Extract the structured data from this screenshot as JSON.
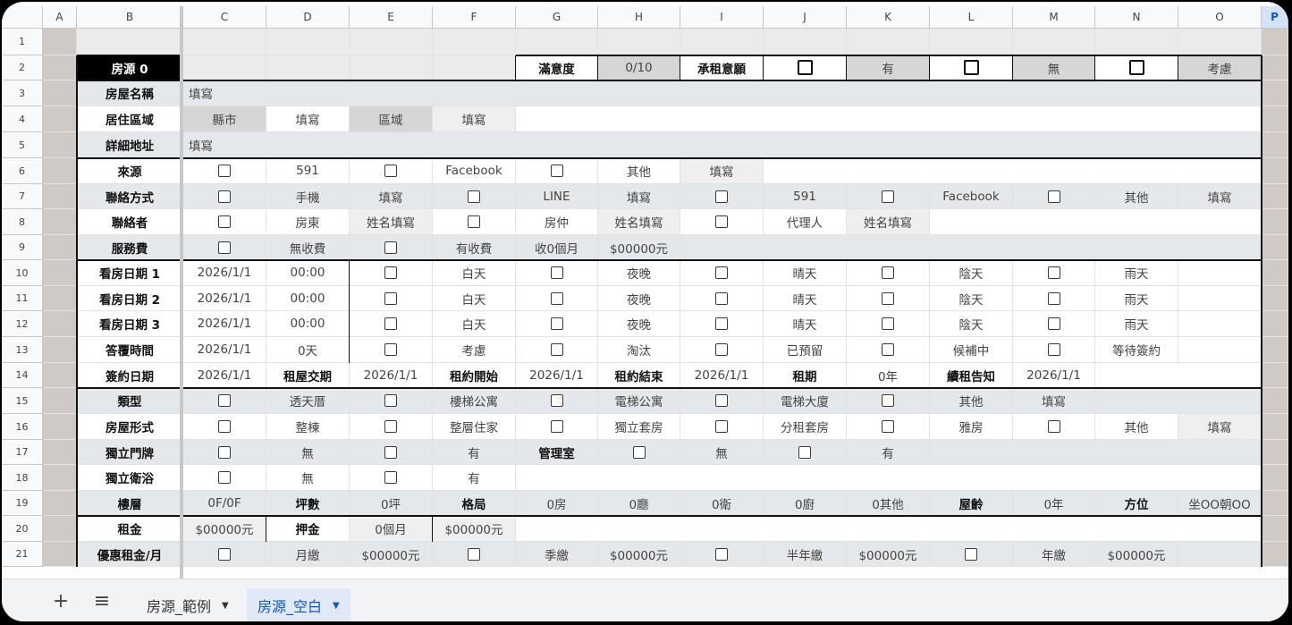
{
  "columns": [
    "A",
    "B",
    "C",
    "D",
    "E",
    "F",
    "G",
    "H",
    "I",
    "J",
    "K",
    "L",
    "M",
    "N",
    "O",
    "P"
  ],
  "selected_column": "P",
  "rows": [
    "1",
    "2",
    "3",
    "4",
    "5",
    "6",
    "7",
    "8",
    "9",
    "10",
    "11",
    "12",
    "13",
    "14",
    "15",
    "16",
    "17",
    "18",
    "19",
    "20",
    "21"
  ],
  "cells": {
    "B2": "房源 0",
    "G2": "滿意度",
    "H2": "0/10",
    "I2": "承租意願",
    "K2": "有",
    "M2": "無",
    "O2": "考慮",
    "B3": "房屋名稱",
    "C3": "填寫",
    "B4": "居住區域",
    "C4": "縣市",
    "D4": "填寫",
    "E4": "區域",
    "F4": "填寫",
    "B5": "詳細地址",
    "C5": "填寫",
    "B6": "來源",
    "D6": "591",
    "F6": "Facebook",
    "H6": "其他",
    "I6": "填寫",
    "B7": "聯絡方式",
    "D7": "手機",
    "E7": "填寫",
    "G7": "LINE",
    "H7": "填寫",
    "J7": "591",
    "L7": "Facebook",
    "N7": "其他",
    "O7": "填寫",
    "B8": "聯絡者",
    "D8": "房東",
    "E8": "姓名填寫",
    "G8": "房仲",
    "H8": "姓名填寫",
    "J8": "代理人",
    "K8": "姓名填寫",
    "B9": "服務費",
    "D9": "無收費",
    "F9": "有收費",
    "G9": "收0個月",
    "H9": "$00000元",
    "B10": "看房日期 1",
    "C10": "2026/1/1",
    "D10": "00:00",
    "F10": "白天",
    "H10": "夜晚",
    "J10": "晴天",
    "L10": "陰天",
    "N10": "雨天",
    "B11": "看房日期 2",
    "C11": "2026/1/1",
    "D11": "00:00",
    "F11": "白天",
    "H11": "夜晚",
    "J11": "晴天",
    "L11": "陰天",
    "N11": "雨天",
    "B12": "看房日期 3",
    "C12": "2026/1/1",
    "D12": "00:00",
    "F12": "白天",
    "H12": "夜晚",
    "J12": "晴天",
    "L12": "陰天",
    "N12": "雨天",
    "B13": "答覆時間",
    "C13": "2026/1/1",
    "D13": "0天",
    "F13": "考慮",
    "H13": "淘汰",
    "J13": "已預留",
    "L13": "候補中",
    "N13": "等待簽約",
    "B14": "簽約日期",
    "C14": "2026/1/1",
    "D14": "租屋交期",
    "E14": "2026/1/1",
    "F14": "租約開始",
    "G14": "2026/1/1",
    "H14": "租約結束",
    "I14": "2026/1/1",
    "J14": "租期",
    "K14": "0年",
    "L14": "續租告知",
    "M14": "2026/1/1",
    "B15": "類型",
    "D15": "透天厝",
    "F15": "樓梯公寓",
    "H15": "電梯公寓",
    "J15": "電梯大廈",
    "L15": "其他",
    "M15": "填寫",
    "B16": "房屋形式",
    "D16": "整棟",
    "F16": "整層住家",
    "H16": "獨立套房",
    "J16": "分租套房",
    "L16": "雅房",
    "N16": "其他",
    "O16": "填寫",
    "B17": "獨立門牌",
    "D17": "無",
    "F17": "有",
    "G17": "管理室",
    "I17": "無",
    "K17": "有",
    "B18": "獨立衛浴",
    "D18": "無",
    "F18": "有",
    "B19": "樓層",
    "C19": "0F/0F",
    "D19": "坪數",
    "E19": "0坪",
    "F19": "格局",
    "G19": "0房",
    "H19": "0廳",
    "I19": "0衛",
    "J19": "0廚",
    "K19": "0其他",
    "L19": "屋齡",
    "M19": "0年",
    "N19": "方位",
    "O19": "坐OO朝OO",
    "B20": "租金",
    "C20": "$00000元",
    "D20": "押金",
    "E20": "0個月",
    "F20": "$00000元",
    "B21": "優惠租金/月",
    "D21": "月繳",
    "E21": "$00000元",
    "G21": "季繳",
    "H21": "$00000元",
    "J21": "半年繳",
    "K21": "$00000元",
    "M21": "年繳",
    "N21": "$00000元"
  },
  "checkboxes": [
    "J2",
    "L2",
    "N2",
    "C6",
    "E6",
    "G6",
    "C7",
    "F7",
    "I7",
    "K7",
    "M7",
    "C8",
    "F8",
    "I8",
    "C9",
    "E9",
    "E10",
    "G10",
    "I10",
    "K10",
    "M10",
    "E11",
    "G11",
    "I11",
    "K11",
    "M11",
    "E12",
    "G12",
    "I12",
    "K12",
    "M12",
    "E13",
    "G13",
    "I13",
    "K13",
    "M13",
    "C15",
    "E15",
    "G15",
    "I15",
    "K15",
    "C16",
    "E16",
    "G16",
    "I16",
    "K16",
    "M16",
    "C17",
    "E17",
    "H17",
    "J17",
    "C18",
    "E18",
    "C21",
    "F21",
    "I21",
    "L21"
  ],
  "bold_cells": [
    "G2",
    "I2",
    "B3",
    "B4",
    "B5",
    "B6",
    "B7",
    "B8",
    "B9",
    "B10",
    "B11",
    "B12",
    "B13",
    "B14",
    "B15",
    "B16",
    "B17",
    "B18",
    "B19",
    "B20",
    "B21",
    "D14",
    "F14",
    "H14",
    "J14",
    "L14",
    "G17",
    "D19",
    "F19",
    "L19",
    "N19",
    "D20"
  ],
  "colors": {
    "header_black": "#000000",
    "cell_gray": "#e5e8eb",
    "input_gray": "#efefef",
    "dark_gray": "#d6d6d6",
    "column_a": "#cfcac6",
    "row1": "#ebebeb",
    "border": "#111111"
  },
  "tabbar": {
    "add_icon": "+",
    "menu_icon": "≡",
    "tabs": [
      {
        "label": "房源_範例",
        "active": false
      },
      {
        "label": "房源_空白",
        "active": true
      }
    ],
    "caret": "▼"
  }
}
